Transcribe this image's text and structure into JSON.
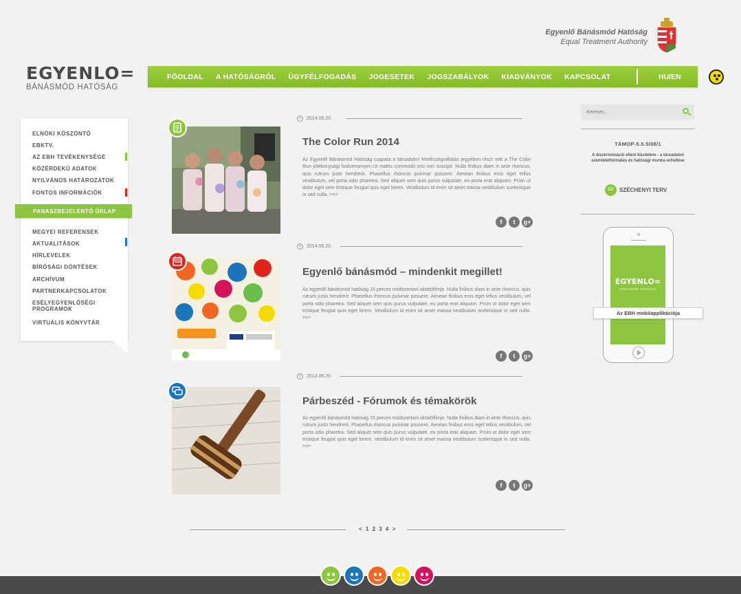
{
  "header": {
    "authority_hu": "Egyenlő Bánásmód Hatóság",
    "authority_en": "Equal Treatment Authority",
    "logo_main": "EGYENLO=",
    "logo_sub": "BÁNÁSMÓD HATÓSÁG"
  },
  "nav": {
    "items": [
      "FŐOLDAL",
      "A HATÓSÁGRÓL",
      "ÜGYFÉLFOGADÁS",
      "JOGESETEK",
      "JOGSZABÁLYOK",
      "KIADVÁNYOK",
      "KAPCSOLAT"
    ],
    "lang": "HU/EN"
  },
  "sidebar": {
    "items": [
      "ELNÖKI KÖSZÖNTŐ",
      "EBKTV.",
      "AZ EBH TEVÉKENYSÉGE",
      "KÖZÉRDEKŰ ADATOK",
      "NYILVÁNOS HATÁROZATOK",
      "FONTOS INFORMÁCIÓK",
      "MEGYEI REFERENSEK",
      "AKTUALITÁSOK",
      "HÍRLEVELEK",
      "BÍRÓSÁGI DÖNTÉSEK",
      "ARCHÍVUM",
      "PARTNERKAPCSOLATOK",
      "ESÉLYEGYENLŐSÉGI PROGRAMOK",
      "VIRTUÁLIS KÖNYVTÁR"
    ],
    "complaint": "PANASZBEJELENTŐ ŰRLAP"
  },
  "articles": [
    {
      "date": "2014.06.20.",
      "title": "The Color Run 2014",
      "text": "Az Egyenlő Bánásmód Hatóság csapata a társadalmi felelősségvállalás jegyében részt vett a The Color Run jótékonysági futóversenyen.Ut mattis commodo orci non suscipit. Nulla finibus diam in ante rhoncus, quis rutrum justo hendrerit. Phasellus rhoncus pulvinar posuere. Aenean finibus eros eget tellus vestibulum, vel porta odio pharetra. Sed aliquet sem quis purus vulputate, eu porta erat aliquam. Proin ut dolor eget sem tristique feugiat quis eget lorem. Vestibulum id enim sit amet massa vestibulum scelerisque in sed nulla. >>>",
      "badge": "document-icon"
    },
    {
      "date": "2014.06.20.",
      "title": "Egyenlő bánásmód – mindenkit megillet!",
      "text": "Az egyenlő bánásmód hatóság 15 perces módszertani oktatófilmje. Nulla finibus diam in ante rhoncus, quis rutrum justo hendrerit. Phasellus rhoncus pulvinar posuere. Aenean finibus eros eget tellus vestibulum, vel porta odio pharetra. Sed aliquet sem quis purus vulputate, eu porta erat aliquam. Proin ut dolor eget sem tristique feugiat quis eget lorem. Vestibulum id enim sit amet massa vestibulum scelerisque in sed nulla. >>>",
      "badge": "calendar-icon"
    },
    {
      "date": "2014.06.20.",
      "title": "Párbeszéd - Fórumok és témakörök",
      "text": "Az egyenlő bánásmód hatóság 15 perces módszertani oktatófilmje. Nulla finibus diam in ante rhoncus, quis rutrum justo hendrerit. Phasellus rhoncus pulvinar posuere. Aenean finibus eros eget tellus vestibulum, vel porta odio pharetra. Sed aliquet sem quis purus vulputate, eu porta erat aliquam. Proin ut dolor eget sem tristique feugiat quis eget lorem. Vestibulum id enim sit amet massa vestibulum scelerisque in sed nulla. >>>",
      "badge": "chat-icon"
    }
  ],
  "social": [
    "f",
    "t",
    "g+"
  ],
  "pager": "< 1 2 3 4 >",
  "right": {
    "search_placeholder": "Keresés...",
    "tamop": "TÁMOP-5.5.5/08/1",
    "tamop_desc": "A diszkrimináció elleni küzdelem - a társadalmi szemléletformálás és hatósági munka erősítése",
    "szechenyi": "SZÉCHENYI TERV",
    "szechenyi_pin": "ÚJ",
    "app_logo": "EGYENLO=",
    "app_logo_sub": "BÁNÁSMÓD HATÓSÁG",
    "app_label": "Az EBH mobilapplikációja"
  },
  "colors": {
    "accent": "#8cc63f",
    "footer": "#4a4a4a",
    "badges": [
      "#8cc63f",
      "#e2231a",
      "#1b75bb"
    ],
    "sidebar_marks": [
      "#8cc63f",
      "#e2231a",
      "#1b75bb"
    ],
    "smileys": [
      "#8cc63f",
      "#1b75bb",
      "#f26522",
      "#f5dc00",
      "#d4145a"
    ]
  }
}
